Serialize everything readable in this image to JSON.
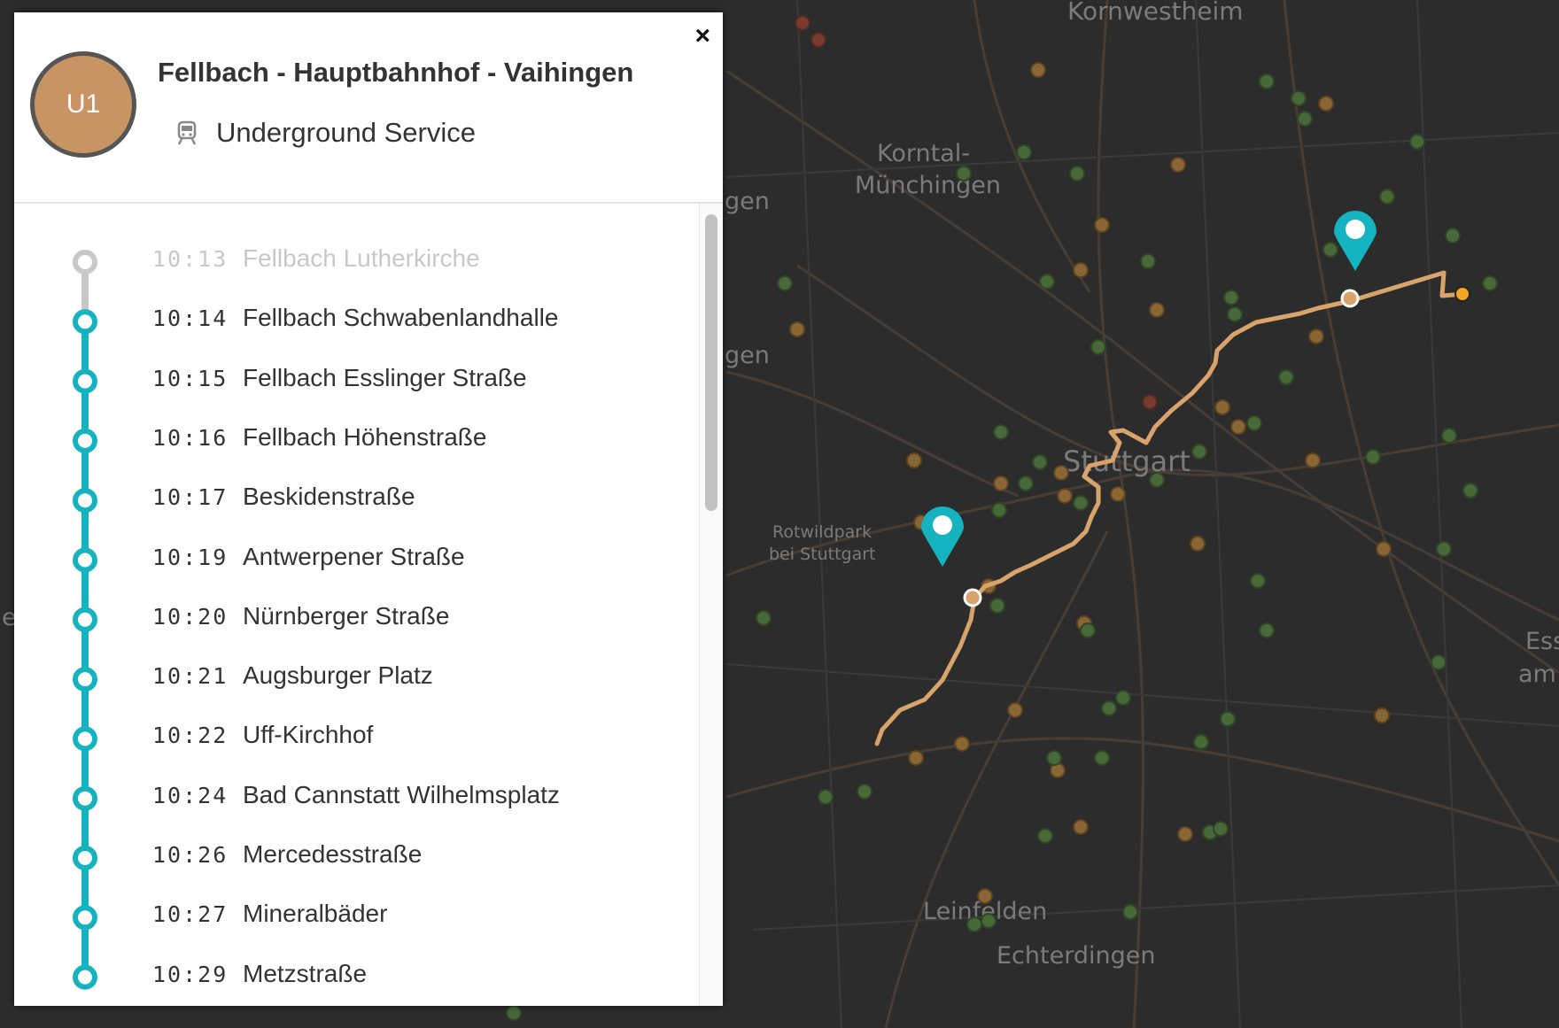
{
  "route": {
    "badge": "U1",
    "title": "Fellbach - Hauptbahnhof - Vaihingen",
    "service": "Underground Service",
    "service_icon": "tram-icon",
    "color": "#c89463"
  },
  "panel": {
    "close_label": "×"
  },
  "stops": [
    {
      "time": "10:13",
      "name": "Fellbach Lutherkirche",
      "past": true
    },
    {
      "time": "10:14",
      "name": "Fellbach Schwabenlandhalle",
      "past": false
    },
    {
      "time": "10:15",
      "name": "Fellbach Esslinger Straße",
      "past": false
    },
    {
      "time": "10:16",
      "name": "Fellbach Höhenstraße",
      "past": false
    },
    {
      "time": "10:17",
      "name": "Beskidenstraße",
      "past": false
    },
    {
      "time": "10:19",
      "name": "Antwerpener Straße",
      "past": false
    },
    {
      "time": "10:20",
      "name": "Nürnberger Straße",
      "past": false
    },
    {
      "time": "10:21",
      "name": "Augsburger Platz",
      "past": false
    },
    {
      "time": "10:22",
      "name": "Uff-Kirchhof",
      "past": false
    },
    {
      "time": "10:24",
      "name": "Bad Cannstatt Wilhelmsplatz",
      "past": false
    },
    {
      "time": "10:26",
      "name": "Mercedesstraße",
      "past": false
    },
    {
      "time": "10:27",
      "name": "Mineralbäder",
      "past": false
    },
    {
      "time": "10:29",
      "name": "Metzstraße",
      "past": false
    }
  ],
  "map": {
    "labels": [
      "Kornwestheim",
      "Korntal-",
      "Münchingen",
      "Stuttgart",
      "Rotwildpark",
      "bei Stuttgart",
      "Leinfelden",
      "Echterdingen",
      "Ess",
      "am",
      "gen",
      "gen",
      "e"
    ],
    "colors": {
      "route": "#d9a36c",
      "marker": "#14b3bf",
      "timeline": "#14b3bf",
      "vehicle": "#f5a623"
    }
  }
}
